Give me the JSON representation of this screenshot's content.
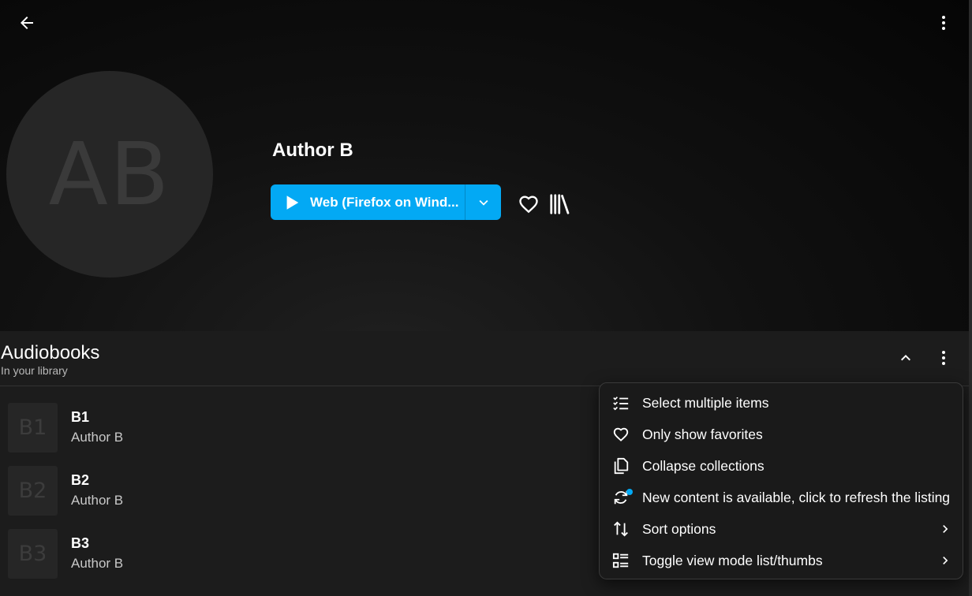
{
  "header": {
    "back_icon": "arrow-left-icon",
    "menu_icon": "dots-vertical-icon"
  },
  "artist": {
    "initials": "AB",
    "name": "Author B",
    "play_label": "Web (Firefox on Wind...",
    "accent": "#03a9f4"
  },
  "section": {
    "title": "Audiobooks",
    "subtitle": "In your library"
  },
  "items": [
    {
      "thumb": "B1",
      "title": "B1",
      "author": "Author B"
    },
    {
      "thumb": "B2",
      "title": "B2",
      "author": "Author B"
    },
    {
      "thumb": "B3",
      "title": "B3",
      "author": "Author B"
    }
  ],
  "menu": {
    "items": [
      {
        "label": "Select multiple items",
        "icon": "checklist-icon"
      },
      {
        "label": "Only show favorites",
        "icon": "heart-outline-icon"
      },
      {
        "label": "Collapse collections",
        "icon": "copy-icon"
      },
      {
        "label": "New content is available, click to refresh the listing",
        "icon": "refresh-icon"
      },
      {
        "label": "Sort options",
        "icon": "sort-icon"
      },
      {
        "label": "Toggle view mode list/thumbs",
        "icon": "view-list-icon"
      }
    ]
  }
}
